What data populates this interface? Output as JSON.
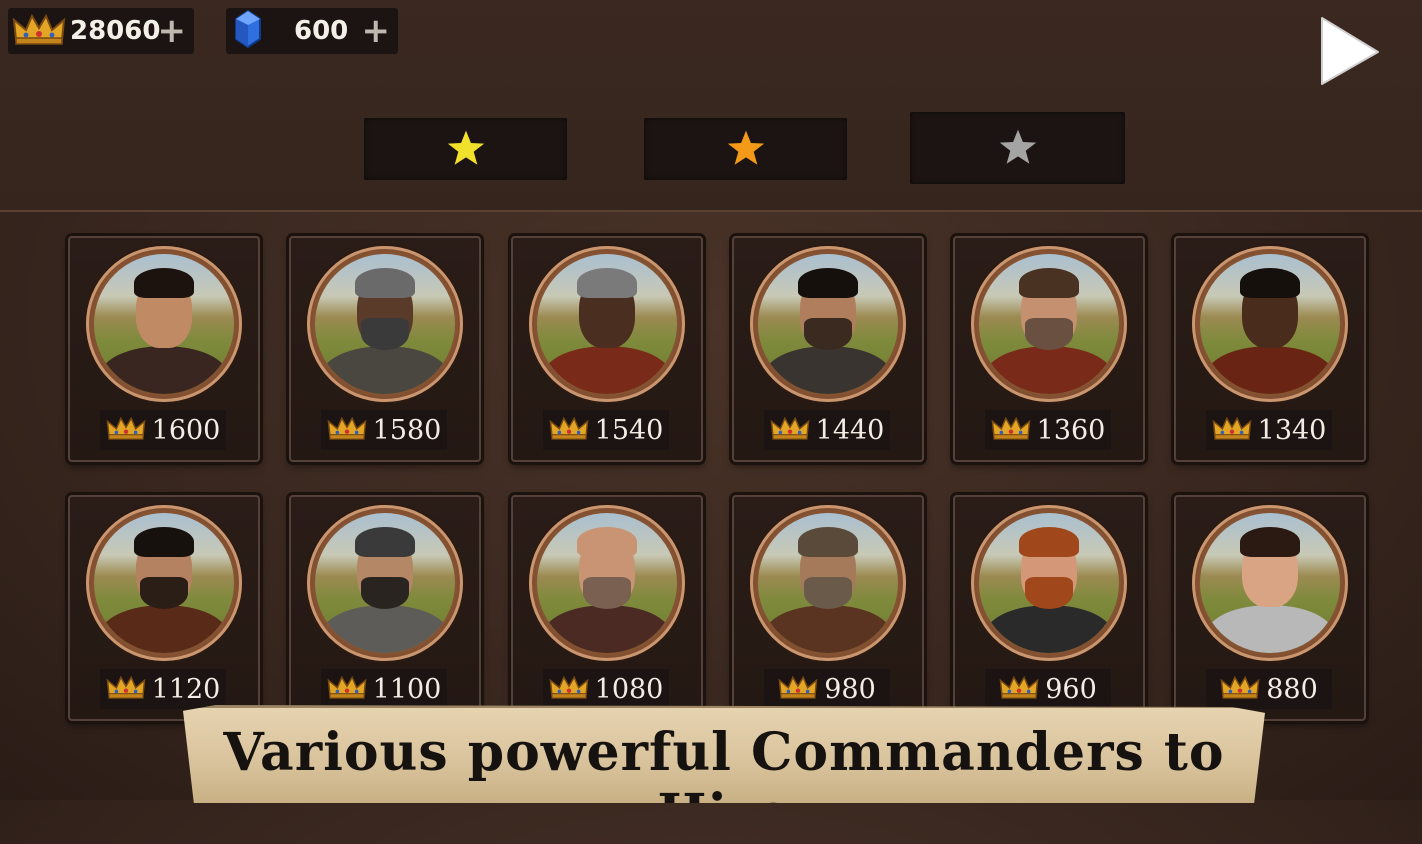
{
  "resources": {
    "gold": {
      "value": "28060",
      "plus": "+",
      "icon": "crown-icon"
    },
    "gems": {
      "value": "600",
      "plus": "+",
      "icon": "gem-icon"
    }
  },
  "tabs": [
    {
      "icon": "star-icon",
      "color": "#f2e12a"
    },
    {
      "icon": "star-icon",
      "color": "#f39a18"
    },
    {
      "icon": "star-icon",
      "color": "#a4a4a4"
    }
  ],
  "commanders_row1": [
    {
      "price": "1600"
    },
    {
      "price": "1580"
    },
    {
      "price": "1540"
    },
    {
      "price": "1440"
    },
    {
      "price": "1360"
    },
    {
      "price": "1340"
    }
  ],
  "commanders_row2": [
    {
      "price": "1120"
    },
    {
      "price": "1100"
    },
    {
      "price": "1080"
    },
    {
      "price": "980"
    },
    {
      "price": "960"
    },
    {
      "price": "880"
    }
  ],
  "banner": {
    "text": "Various powerful Commanders to Hire"
  },
  "colors": {
    "background": "#3a2820",
    "panel": "#1b1412",
    "banner": "#dcc7a0",
    "crown_gold": "#e2a525"
  }
}
